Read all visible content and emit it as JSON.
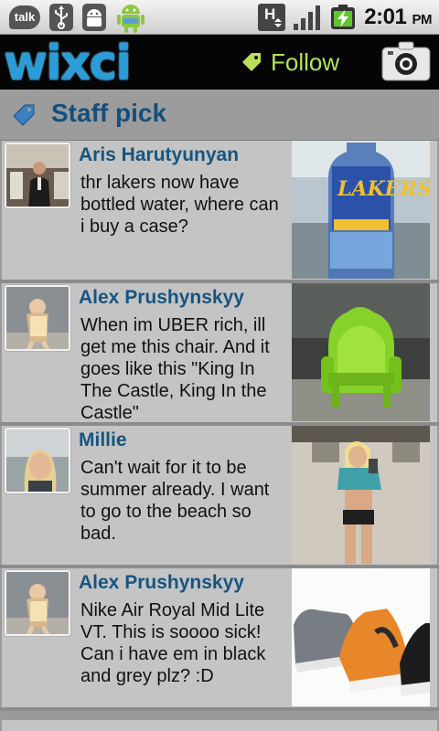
{
  "status_bar": {
    "icons": [
      "talk-icon",
      "usb-icon",
      "android-debug-icon",
      "android-notification-icon",
      "h-network-icon",
      "signal-icon",
      "battery-charging-icon"
    ],
    "talk_label": "talk",
    "network_label": "H",
    "time": "2:01",
    "ampm": "PM"
  },
  "app": {
    "logo": "wixci",
    "follow_label": "Follow",
    "brand_color": "#2a9cd8",
    "follow_color": "#b6e05a"
  },
  "section": {
    "title": "Staff pick",
    "title_color": "#134f7c"
  },
  "posts": [
    {
      "name": "Aris Harutyunyan",
      "text": "thr lakers now have bottled water, where can i buy a case?",
      "photo": "lakers-water-bottle"
    },
    {
      "name": "Alex Prushynskyy",
      "text": "When im UBER rich, ill get me this chair. And it goes like this \"King In The Castle, King In the Castle\"",
      "photo": "green-throne-chair"
    },
    {
      "name": "Millie",
      "text": "Can't wait for it to be summer already. I want to go to the beach so bad.",
      "photo": "mirror-selfie"
    },
    {
      "name": "Alex Prushynskyy",
      "text": "Nike Air Royal Mid Lite VT. This is soooo sick! Can i have em in black and grey plz? :D",
      "photo": "sneakers"
    }
  ]
}
